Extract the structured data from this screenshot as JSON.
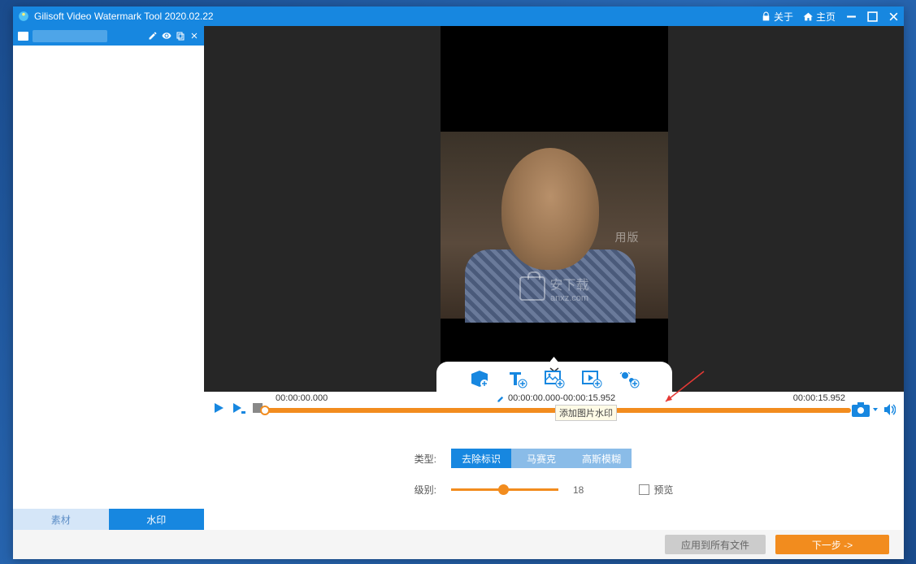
{
  "titlebar": {
    "title": "Gilisoft Video Watermark Tool 2020.02.22",
    "about": "关于",
    "home": "主页"
  },
  "sidebar": {
    "tabs": {
      "material": "素材",
      "watermark": "水印"
    }
  },
  "tray": {
    "tooltip": "添加图片水印"
  },
  "timeline": {
    "start": "00:00:00.000",
    "range": "00:00:00.000-00:00:15.952",
    "end": "00:00:15.952"
  },
  "preview": {
    "wm_right": "用版",
    "wm_center_line1": "安下载",
    "wm_center_line2": "anxz.com"
  },
  "controls": {
    "type_label": "类型:",
    "types": {
      "remove": "去除标识",
      "mosaic": "马赛克",
      "blur": "高斯模糊"
    },
    "level_label": "级别:",
    "level_value": "18",
    "preview_label": "预览"
  },
  "footer": {
    "apply_all": "应用到所有文件",
    "next": "下一步 ->"
  }
}
